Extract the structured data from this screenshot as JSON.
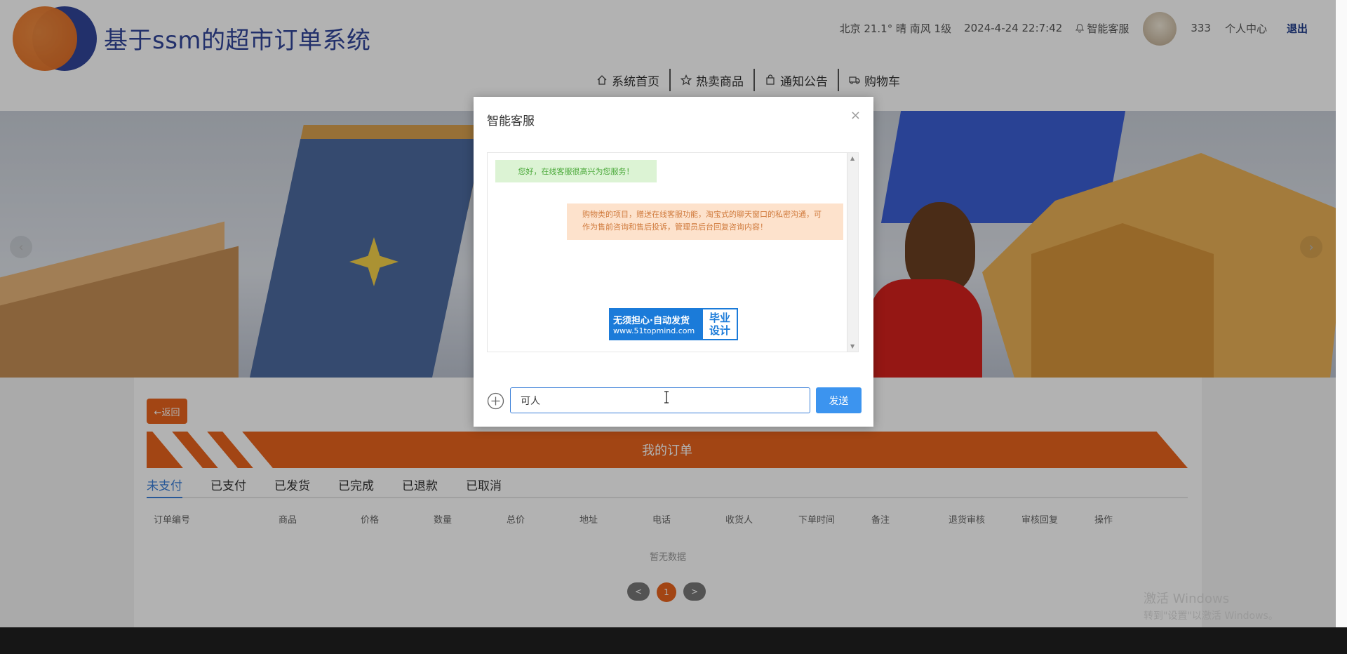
{
  "header": {
    "site_title": "基于ssm的超市订单系统",
    "weather": "北京  21.1°  晴  南风  1级",
    "datetime": "2024-4-24 22:7:42",
    "smart_service": "智能客服",
    "username": "333",
    "profile_link": "个人中心",
    "logout": "退出"
  },
  "nav": [
    {
      "label": "系统首页",
      "icon": "home-icon"
    },
    {
      "label": "热卖商品",
      "icon": "star-icon"
    },
    {
      "label": "通知公告",
      "icon": "bag-icon"
    },
    {
      "label": "购物车",
      "icon": "truck-icon"
    }
  ],
  "banner": {
    "prev": "‹",
    "next": "›"
  },
  "orders": {
    "back_label": "←返回",
    "title": "我的订单",
    "tabs": [
      "未支付",
      "已支付",
      "已发货",
      "已完成",
      "已退款",
      "已取消"
    ],
    "active_tab": 0,
    "columns": [
      "订单编号",
      "商品",
      "价格",
      "数量",
      "总价",
      "地址",
      "电话",
      "收货人",
      "下单时间",
      "备注",
      "退货审核",
      "审核回复",
      "操作"
    ],
    "empty_text": "暂无数据",
    "pager": {
      "prev": "<",
      "current": "1",
      "next": ">"
    }
  },
  "dialog": {
    "title": "智能客服",
    "close": "×",
    "messages": {
      "welcome": "您好，在线客服很高兴为您服务！",
      "info": "购物类的项目，赠送在线客服功能，淘宝式的聊天窗口的私密沟通，可作为售前咨询和售后投诉，管理员后台回复咨询内容！"
    },
    "promo": {
      "line1": "无须担心·自动发货",
      "line2": "www.51topmind.com",
      "side1": "毕业",
      "side2": "设计"
    },
    "input_value": "可人",
    "send_label": "发送"
  },
  "watermark": {
    "line1": "激活 Windows",
    "line2": "转到\"设置\"以激活 Windows。"
  },
  "colors": {
    "accent": "#e8641e",
    "primary": "#3c94ef",
    "brand": "#31459a"
  }
}
